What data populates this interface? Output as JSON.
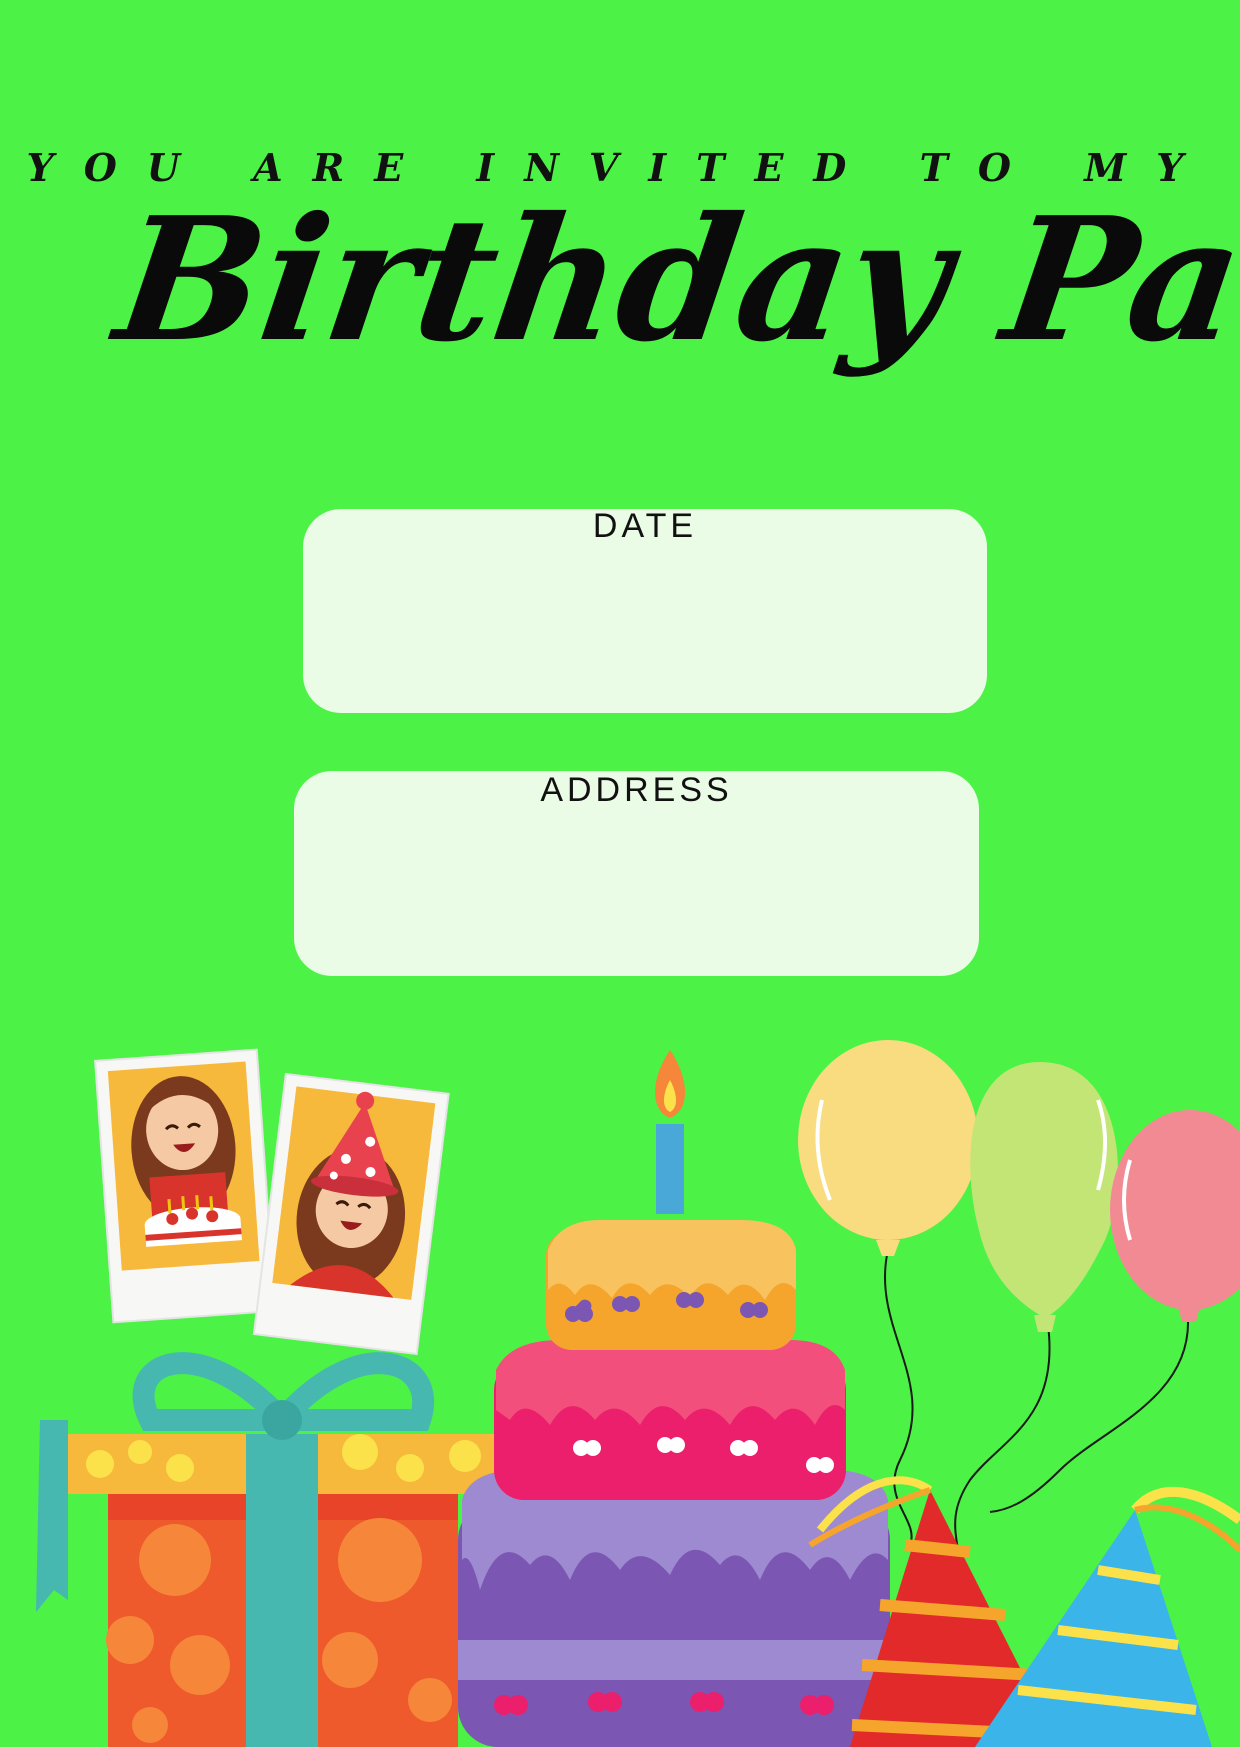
{
  "invitation": {
    "subtitle": "You are invited to my",
    "title": "Birthday Party!"
  },
  "fields": {
    "date": {
      "label": "DATE",
      "value": ""
    },
    "address": {
      "label": "ADDRESS",
      "value": ""
    }
  },
  "colors": {
    "background": "#4cf245",
    "box": "#eafbe6",
    "text": "#0a0a0a"
  },
  "decorations": {
    "photos": [
      "photo-girl-with-cake",
      "photo-girl-with-party-hat"
    ],
    "gift": "gift-box-icon",
    "cake": "birthday-cake-icon",
    "balloons": [
      "yellow-balloon-icon",
      "green-balloon-icon",
      "pink-balloon-icon"
    ],
    "party_hats": [
      "red-party-hat-icon",
      "blue-party-hat-icon"
    ]
  }
}
